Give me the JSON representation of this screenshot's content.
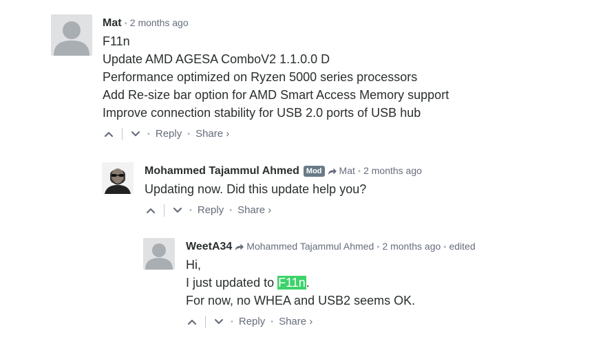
{
  "comments": [
    {
      "author": "Mat",
      "time": "2 months ago",
      "lines": [
        "F11n",
        "Update AMD AGESA ComboV2 1.1.0.0 D",
        "Performance optimized on Ryzen 5000 series processors",
        "Add Re-size bar option for AMD Smart Access Memory support",
        "Improve connection stability for USB 2.0 ports of USB hub"
      ],
      "reply_label": "Reply",
      "share_label": "Share ›",
      "avatar_icon": "default-avatar-icon"
    },
    {
      "author": "Mohammed Tajammul Ahmed",
      "badge": "Mod",
      "parent": "Mat",
      "time": "2 months ago",
      "lines": [
        "Updating now. Did this update help you?"
      ],
      "reply_label": "Reply",
      "share_label": "Share ›",
      "avatar_icon": "user-photo-avatar"
    },
    {
      "author": "WeetA34",
      "parent": "Mohammed Tajammul Ahmed",
      "time": "2 months ago",
      "edited": "edited",
      "lines": [
        "Hi,",
        "I just updated to ",
        ".",
        "For now, no WHEA and USB2 seems OK."
      ],
      "highlight": "F11n",
      "reply_label": "Reply",
      "share_label": "Share ›",
      "avatar_icon": "default-avatar-icon"
    }
  ],
  "colors": {
    "text": "#2a2e2e",
    "meta": "#656c7a",
    "badge": "#687a86",
    "highlight": "#3cd36a"
  },
  "icons": [
    "upvote-icon",
    "downvote-icon",
    "reply-arrow-icon"
  ]
}
